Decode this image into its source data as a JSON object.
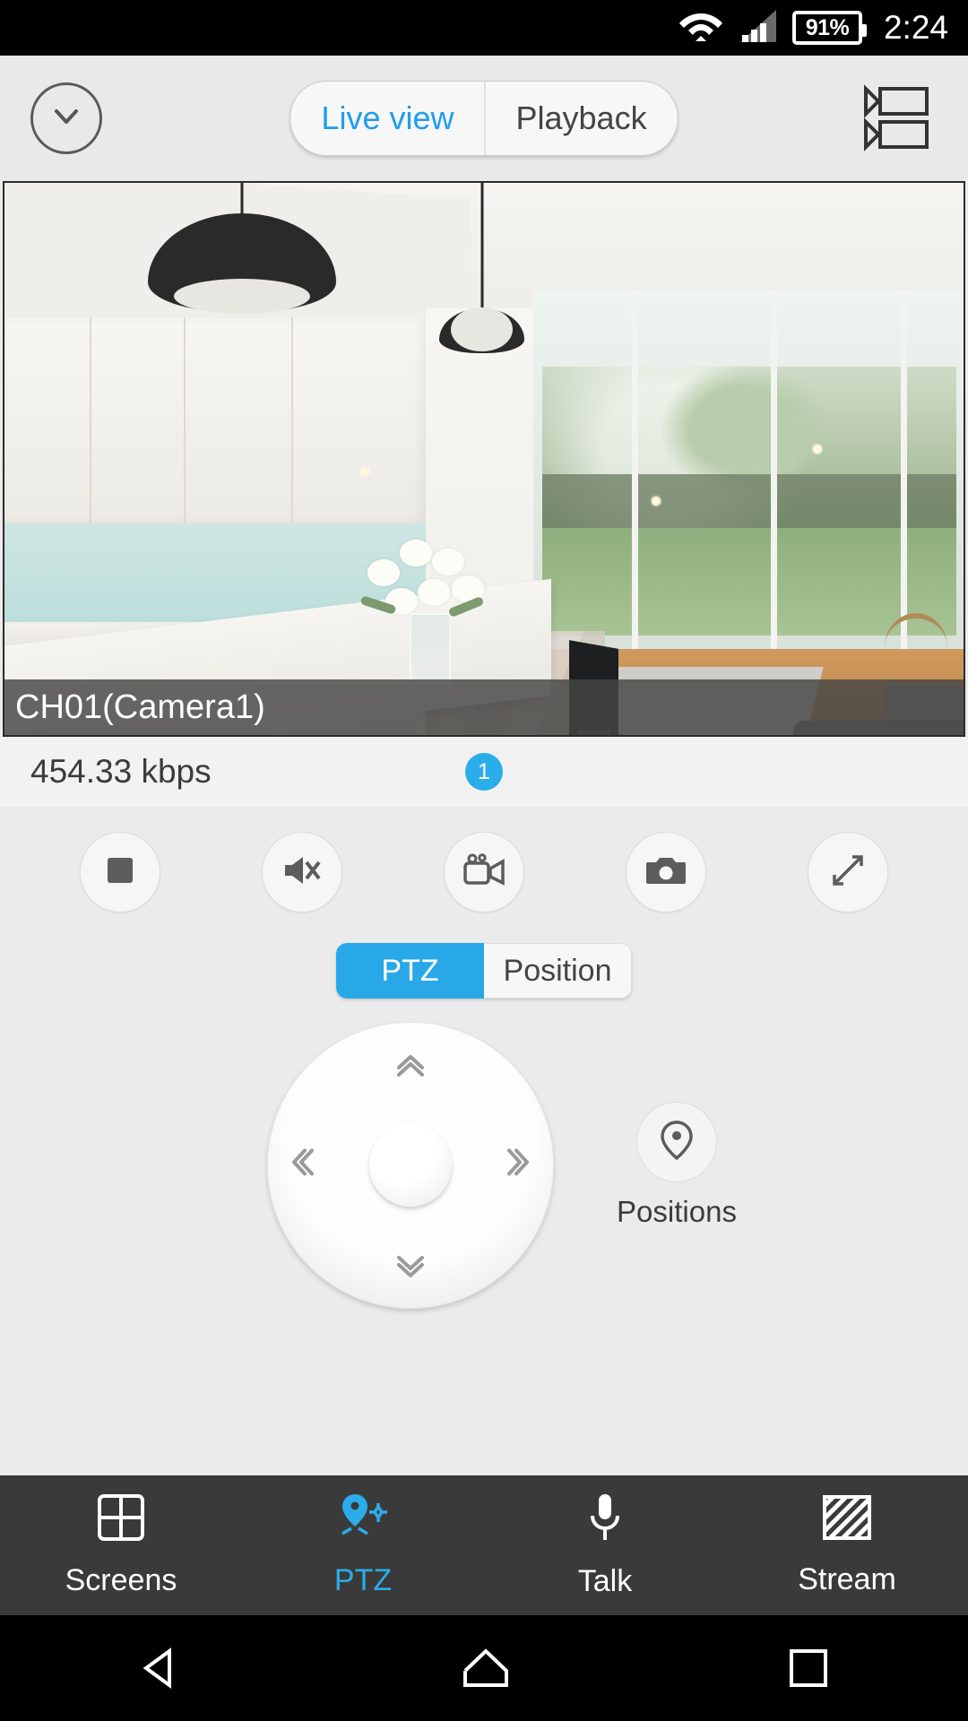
{
  "statusbar": {
    "wifi_icon": "wifi-icon",
    "signal_icon": "cellular-signal-icon",
    "battery_icon": "battery-icon",
    "battery_label": "91%",
    "clock": "2:24"
  },
  "topbar": {
    "collapse_icon": "chevron-down-circle-icon",
    "tabs": [
      {
        "label": "Live view",
        "active": true
      },
      {
        "label": "Playback",
        "active": false
      }
    ],
    "film_icon": "film-clips-icon"
  },
  "video": {
    "channel_label": "CH01(Camera1)",
    "scene_description": "kitchen-living-room"
  },
  "stats": {
    "bitrate": "454.33 kbps",
    "badge_count": "1",
    "badge_color": "#2badea"
  },
  "tools": [
    {
      "name": "stop-button",
      "icon": "stop-square-icon"
    },
    {
      "name": "mute-button",
      "icon": "speaker-mute-icon"
    },
    {
      "name": "record-button",
      "icon": "video-camera-icon"
    },
    {
      "name": "snapshot-button",
      "icon": "camera-icon"
    },
    {
      "name": "fullscreen-button",
      "icon": "expand-arrows-icon"
    }
  ],
  "mode_tabs": [
    {
      "label": "PTZ",
      "active": true
    },
    {
      "label": "Position",
      "active": false
    }
  ],
  "ptz": {
    "up_icon": "chevron-up-double-icon",
    "down_icon": "chevron-down-double-icon",
    "left_icon": "chevron-left-double-icon",
    "right_icon": "chevron-right-double-icon",
    "center_icon": "joystick-nub-icon",
    "positions_icon": "map-pin-icon",
    "positions_label": "Positions"
  },
  "bottom_nav": [
    {
      "label": "Screens",
      "icon": "grid-four-icon",
      "active": false
    },
    {
      "label": "PTZ",
      "icon": "ptz-pin-icon",
      "active": true
    },
    {
      "label": "Talk",
      "icon": "microphone-icon",
      "active": false
    },
    {
      "label": "Stream",
      "icon": "stream-stripes-icon",
      "active": false
    }
  ],
  "android_nav": {
    "back_icon": "triangle-back-icon",
    "home_icon": "home-icon",
    "recents_icon": "square-recents-icon"
  },
  "colors": {
    "accent": "#2badea",
    "panel_bg": "#ebebeb",
    "navbar_bg": "#3a3a3a"
  }
}
